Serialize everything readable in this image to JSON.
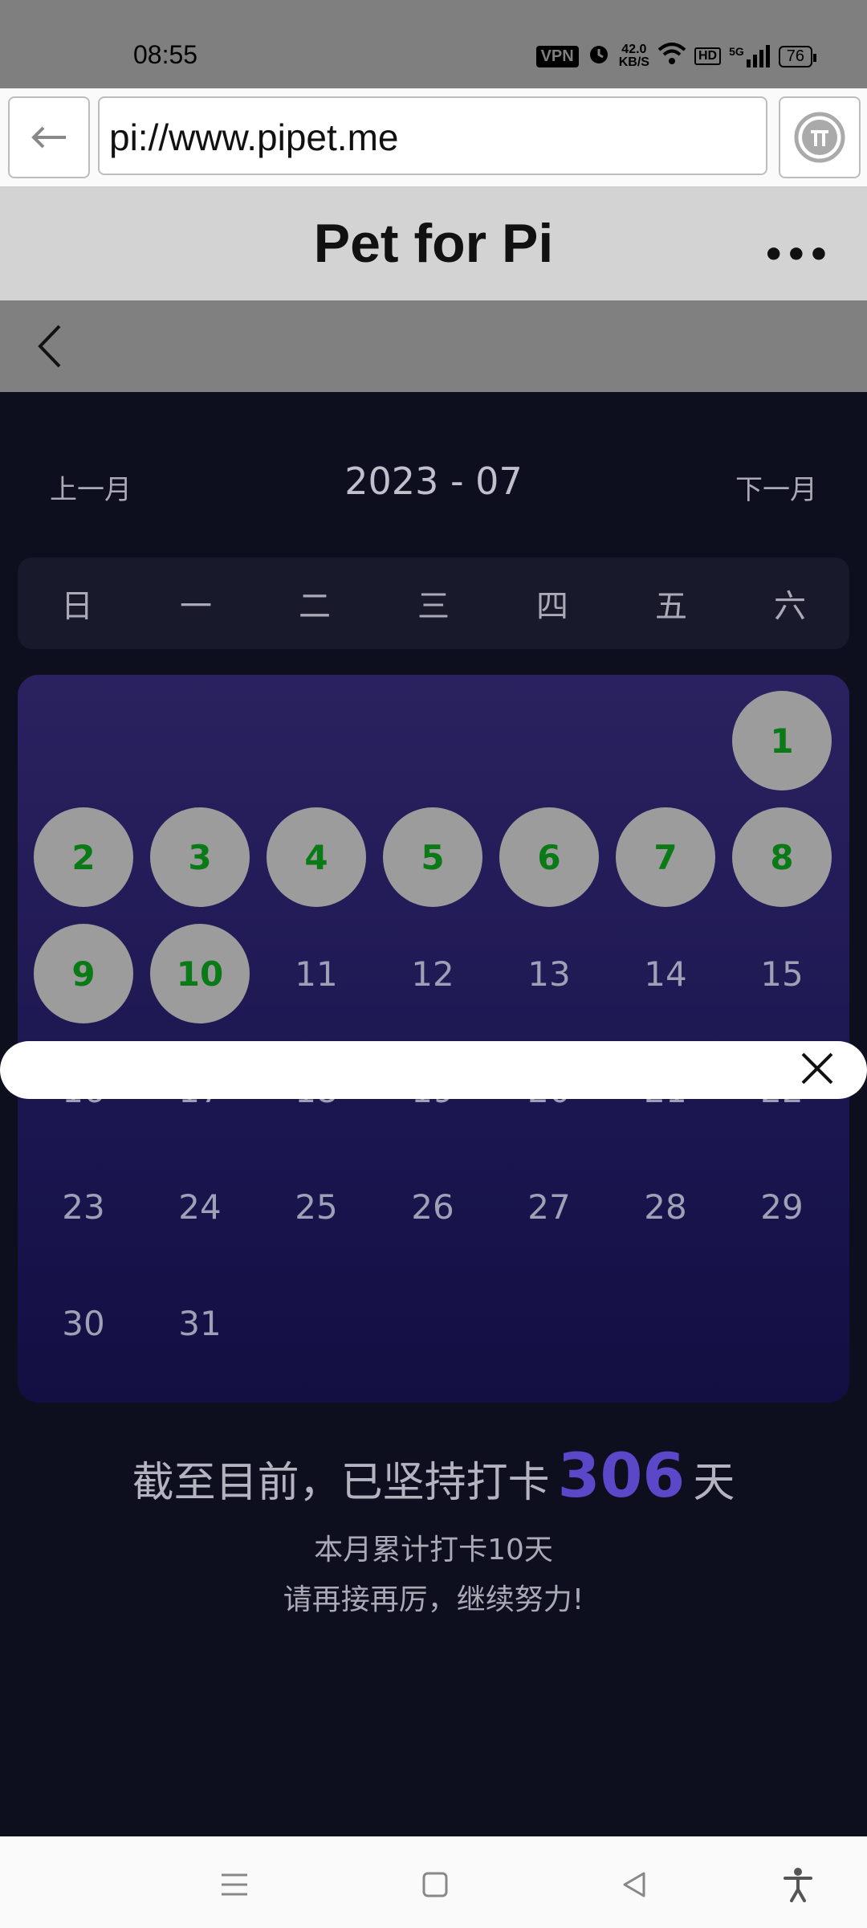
{
  "status_bar": {
    "time": "08:55",
    "vpn": "VPN",
    "speed_value": "42.0",
    "speed_unit": "KB/S",
    "network": "5G",
    "hd": "HD",
    "battery": "76",
    "icons": [
      "alarm-icon",
      "wifi-icon",
      "signal-icon",
      "battery-icon"
    ]
  },
  "browser": {
    "url": "pi://www.pipet.me",
    "back_icon": "arrow-left-icon",
    "pi_icon": "pi-logo-icon"
  },
  "header": {
    "title": "Pet for Pi",
    "more": "•••"
  },
  "calendar": {
    "prev": "上一月",
    "next": "下一月",
    "month": "2023 - 07",
    "weekdays": [
      "日",
      "一",
      "二",
      "三",
      "四",
      "五",
      "六"
    ],
    "days": [
      "1",
      "2",
      "3",
      "4",
      "5",
      "6",
      "7",
      "8",
      "9",
      "10",
      "11",
      "12",
      "13",
      "14",
      "15",
      "16",
      "17",
      "18",
      "19",
      "20",
      "21",
      "22",
      "23",
      "24",
      "25",
      "26",
      "27",
      "28",
      "29",
      "30",
      "31"
    ],
    "checked_days": [
      1,
      2,
      3,
      4,
      5,
      6,
      7,
      8,
      9,
      10
    ],
    "first_weekday_index": 6,
    "checked_color": "#0a7a16"
  },
  "stats": {
    "prefix": "截至目前，已坚持打卡",
    "count": "306",
    "suffix": "天",
    "month_total": "本月累计打卡10天",
    "encourage": "请再接再厉，继续努力!"
  },
  "colors": {
    "accent": "#5a48c8",
    "background": "#0e0f1e"
  }
}
